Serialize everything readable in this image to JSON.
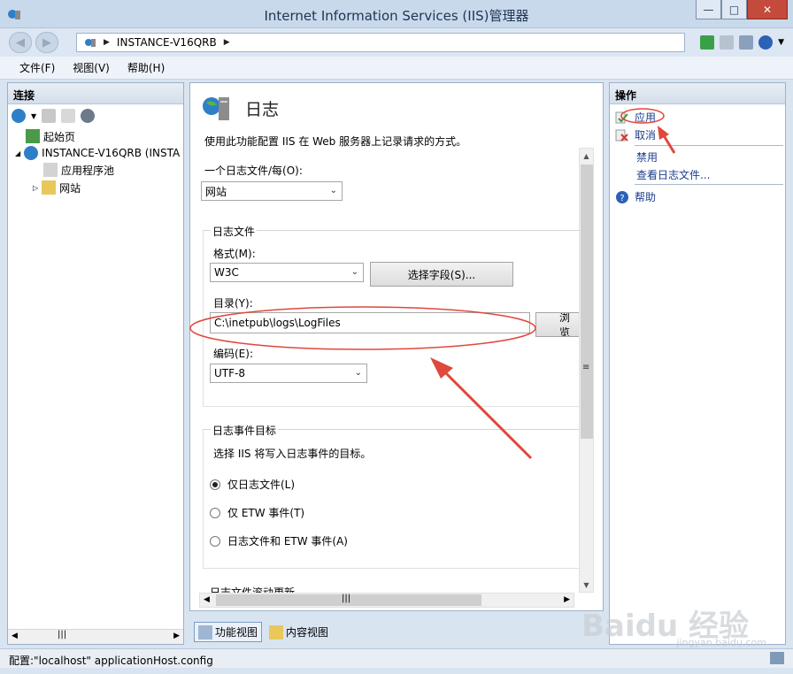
{
  "window": {
    "title": "Internet Information Services (IIS)管理器"
  },
  "address": {
    "path": "INSTANCE-V16QRB"
  },
  "menu": [
    "文件(F)",
    "视图(V)",
    "帮助(H)"
  ],
  "left_pane": {
    "header": "连接",
    "tree": [
      {
        "label": "起始页"
      },
      {
        "label": "INSTANCE-V16QRB (INSTA"
      },
      {
        "label": "应用程序池"
      },
      {
        "label": "网站"
      }
    ]
  },
  "center_pane": {
    "title": "日志",
    "description": "使用此功能配置 IIS 在 Web 服务器上记录请求的方式。",
    "one_log_label": "一个日志文件/每(O):",
    "one_log_value": "网站",
    "log_file_group": "日志文件",
    "format_label": "格式(M):",
    "format_value": "W3C",
    "select_fields_button": "选择字段(S)...",
    "directory_label": "目录(Y):",
    "directory_value": "C:\\inetpub\\logs\\LogFiles",
    "browse_button": "浏览",
    "encoding_label": "编码(E):",
    "encoding_value": "UTF-8",
    "event_group": "日志事件目标",
    "event_desc": "选择 IIS 将写入日志事件的目标。",
    "radio_options": [
      {
        "label": "仅日志文件(L)",
        "checked": true
      },
      {
        "label": "仅 ETW 事件(T)",
        "checked": false
      },
      {
        "label": "日志文件和 ETW 事件(A)",
        "checked": false
      }
    ],
    "rollover_group": "日志文件滚动更新"
  },
  "view_tabs": [
    "功能视图",
    "内容视图"
  ],
  "right_pane": {
    "header": "操作",
    "actions": [
      "应用",
      "取消",
      "禁用",
      "查看日志文件...",
      "帮助"
    ]
  },
  "status": "配置:\"localhost\" applicationHost.config",
  "watermark": {
    "text": "Baidu 经验",
    "sub": "jingyan.baidu.com"
  },
  "colors": {
    "annotation_red": "#e0483c",
    "link_blue": "#1b3d8f"
  }
}
